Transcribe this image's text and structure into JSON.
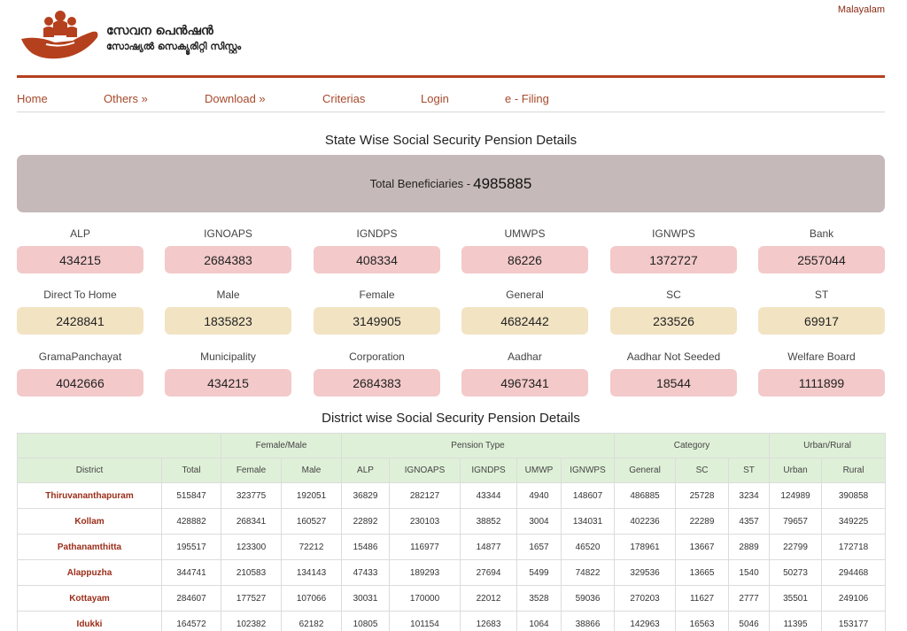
{
  "header": {
    "language_link": "Malayalam",
    "brand_title": "സേവന പെൻഷൻ",
    "brand_subtitle": "സോഷ്യൽ സെക്യൂരിറ്റി സിസ്റ്റം"
  },
  "nav": {
    "items": [
      "Home",
      "Others »",
      "Download »",
      "Criterias",
      "Login",
      "e - Filing"
    ]
  },
  "state_section": {
    "title": "State Wise Social Security Pension Details",
    "total_label": "Total Beneficiaries -",
    "total_value": "4985885",
    "stats": [
      {
        "label": "ALP",
        "value": "434215"
      },
      {
        "label": "IGNOAPS",
        "value": "2684383"
      },
      {
        "label": "IGNDPS",
        "value": "408334"
      },
      {
        "label": "UMWPS",
        "value": "86226"
      },
      {
        "label": "IGNWPS",
        "value": "1372727"
      },
      {
        "label": "Bank",
        "value": "2557044"
      },
      {
        "label": "Direct To Home",
        "value": "2428841"
      },
      {
        "label": "Male",
        "value": "1835823"
      },
      {
        "label": "Female",
        "value": "3149905"
      },
      {
        "label": "General",
        "value": "4682442"
      },
      {
        "label": "SC",
        "value": "233526"
      },
      {
        "label": "ST",
        "value": "69917"
      },
      {
        "label": "GramaPanchayat",
        "value": "4042666"
      },
      {
        "label": "Municipality",
        "value": "434215"
      },
      {
        "label": "Corporation",
        "value": "2684383"
      },
      {
        "label": "Aadhar",
        "value": "4967341"
      },
      {
        "label": "Aadhar Not Seeded",
        "value": "18544"
      },
      {
        "label": "Welfare Board",
        "value": "1111899"
      }
    ]
  },
  "district_section": {
    "title": "District wise Social Security Pension Details",
    "group_headers": [
      "Female/Male",
      "Pension Type",
      "Category",
      "Urban/Rural"
    ],
    "columns": [
      "District",
      "Total",
      "Female",
      "Male",
      "ALP",
      "IGNOAPS",
      "IGNDPS",
      "UMWP",
      "IGNWPS",
      "General",
      "SC",
      "ST",
      "Urban",
      "Rural"
    ],
    "rows": [
      [
        "Thiruvananthapuram",
        "515847",
        "323775",
        "192051",
        "36829",
        "282127",
        "43344",
        "4940",
        "148607",
        "486885",
        "25728",
        "3234",
        "124989",
        "390858"
      ],
      [
        "Kollam",
        "428882",
        "268341",
        "160527",
        "22892",
        "230103",
        "38852",
        "3004",
        "134031",
        "402236",
        "22289",
        "4357",
        "79657",
        "349225"
      ],
      [
        "Pathanamthitta",
        "195517",
        "123300",
        "72212",
        "15486",
        "116977",
        "14877",
        "1657",
        "46520",
        "178961",
        "13667",
        "2889",
        "22799",
        "172718"
      ],
      [
        "Alappuzha",
        "344741",
        "210583",
        "134143",
        "47433",
        "189293",
        "27694",
        "5499",
        "74822",
        "329536",
        "13665",
        "1540",
        "50273",
        "294468"
      ],
      [
        "Kottayam",
        "284607",
        "177527",
        "107066",
        "30031",
        "170000",
        "22012",
        "3528",
        "59036",
        "270203",
        "11627",
        "2777",
        "35501",
        "249106"
      ],
      [
        "Idukki",
        "164572",
        "102382",
        "62182",
        "10805",
        "101154",
        "12683",
        "1064",
        "38866",
        "142963",
        "16563",
        "5046",
        "11395",
        "153177"
      ]
    ]
  },
  "colors": {
    "brand": "#b5401d",
    "link": "#a64a2c",
    "total_box": "#c6b9b9",
    "stat_pink": "#f3c9c9",
    "stat_cream": "#f2e3c3",
    "table_header": "#dff0d8",
    "district_name": "#9b2d18"
  }
}
